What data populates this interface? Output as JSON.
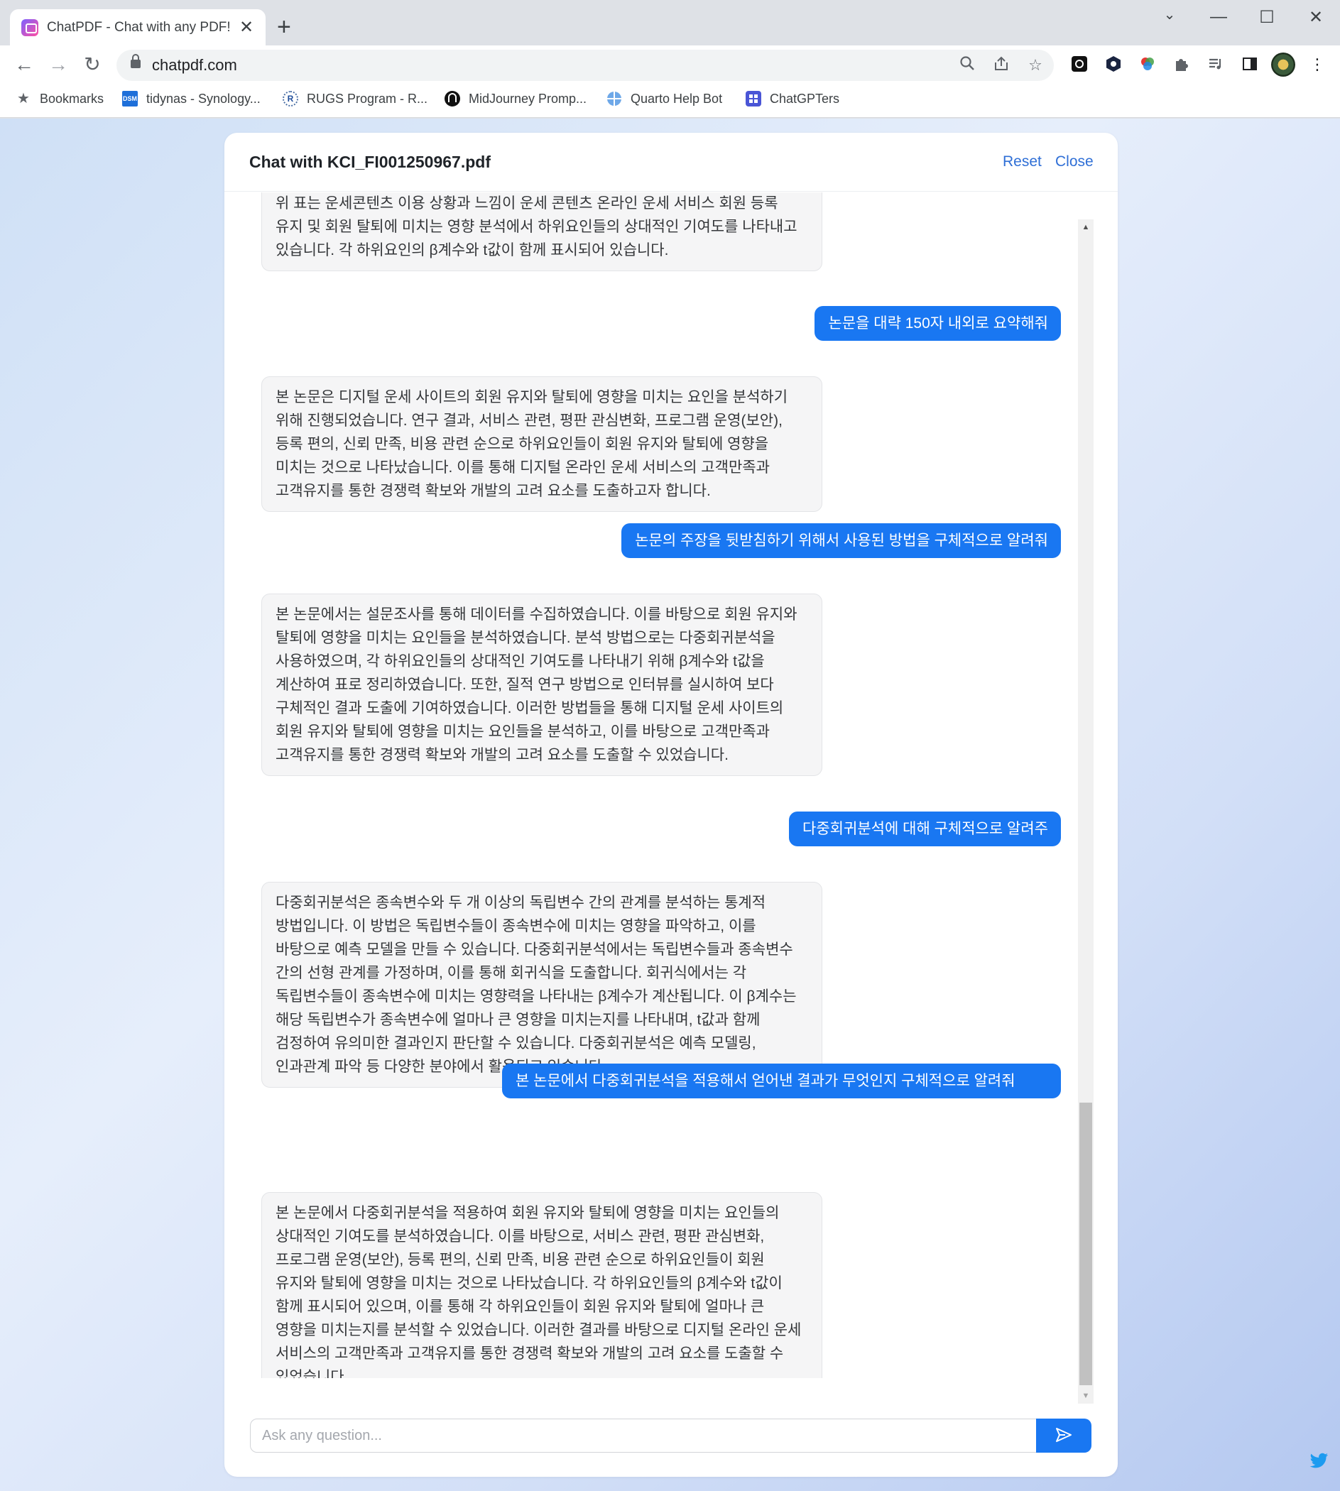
{
  "browser": {
    "tab_title": "ChatPDF - Chat with any PDF!",
    "tab_close": "✕",
    "new_tab": "+",
    "url": "chatpdf.com",
    "bookmarks": [
      {
        "label": "Bookmarks",
        "icon": "star-icon"
      },
      {
        "label": "tidynas - Synology...",
        "icon": "dsm-icon"
      },
      {
        "label": "RUGS Program - R...",
        "icon": "r-icon"
      },
      {
        "label": "MidJourney Promp...",
        "icon": "midjourney-icon"
      },
      {
        "label": "Quarto Help Bot",
        "icon": "globe-icon"
      },
      {
        "label": "ChatGPTers",
        "icon": "discord-icon"
      }
    ],
    "dsm_badge": "DSM",
    "r_badge": "R"
  },
  "chat": {
    "title": "Chat with KCI_FI001250967.pdf",
    "reset_label": "Reset",
    "close_label": "Close",
    "messages": [
      {
        "role": "ai",
        "text": "위 표는 운세콘텐츠 이용 상황과 느낌이 운세 콘텐츠 온라인 운세 서비스 회원 등록 유지 및 회원 탈퇴에 미치는 영향 분석에서 하위요인들의 상대적인 기여도를 나타내고 있습니다. 각 하위요인의 β계수와 t값이 함께 표시되어 있습니다."
      },
      {
        "role": "user",
        "text": "논문을 대략 150자 내외로 요약해줘"
      },
      {
        "role": "ai",
        "text": "본 논문은 디지털 운세 사이트의 회원 유지와 탈퇴에 영향을 미치는 요인을 분석하기 위해 진행되었습니다. 연구 결과, 서비스 관련, 평판 관심변화, 프로그램 운영(보안), 등록 편의, 신뢰 만족, 비용 관련 순으로 하위요인들이 회원 유지와 탈퇴에 영향을 미치는 것으로 나타났습니다. 이를 통해 디지털 온라인 운세 서비스의 고객만족과 고객유지를 통한 경쟁력 확보와 개발의 고려 요소를 도출하고자 합니다."
      },
      {
        "role": "user",
        "text": "논문의 주장을 뒷받침하기 위해서 사용된 방법을 구체적으로 알려줘"
      },
      {
        "role": "ai",
        "text": "본 논문에서는 설문조사를 통해 데이터를 수집하였습니다. 이를 바탕으로 회원 유지와 탈퇴에 영향을 미치는 요인들을 분석하였습니다. 분석 방법으로는 다중회귀분석을 사용하였으며, 각 하위요인들의 상대적인 기여도를 나타내기 위해 β계수와 t값을 계산하여 표로 정리하였습니다. 또한, 질적 연구 방법으로 인터뷰를 실시하여 보다 구체적인 결과 도출에 기여하였습니다. 이러한 방법들을 통해 디지털 운세 사이트의 회원 유지와 탈퇴에 영향을 미치는 요인들을 분석하고, 이를 바탕으로 고객만족과 고객유지를 통한 경쟁력 확보와 개발의 고려 요소를 도출할 수 있었습니다."
      },
      {
        "role": "user",
        "text": "다중회귀분석에 대해 구체적으로 알려주"
      },
      {
        "role": "ai",
        "text": "다중회귀분석은 종속변수와 두 개 이상의 독립변수 간의 관계를 분석하는 통계적 방법입니다. 이 방법은 독립변수들이 종속변수에 미치는 영향을 파악하고, 이를 바탕으로 예측 모델을 만들 수 있습니다. 다중회귀분석에서는 독립변수들과 종속변수 간의 선형 관계를 가정하며, 이를 통해 회귀식을 도출합니다. 회귀식에서는 각 독립변수들이 종속변수에 미치는 영향력을 나타내는 β계수가 계산됩니다. 이 β계수는 해당 독립변수가 종속변수에 얼마나 큰 영향을 미치는지를 나타내며, t값과 함께 검정하여 유의미한 결과인지 판단할 수 있습니다. 다중회귀분석은 예측 모델링, 인과관계 파악 등 다양한 분야에서 활용되고 있습니다."
      },
      {
        "role": "user",
        "text": "본 논문에서 다중회귀분석을 적용해서 얻어낸 결과가 무엇인지 구체적으로 알려줘"
      },
      {
        "role": "ai",
        "text": "본 논문에서 다중회귀분석을 적용하여 회원 유지와 탈퇴에 영향을 미치는 요인들의 상대적인 기여도를 분석하였습니다. 이를 바탕으로, 서비스 관련, 평판 관심변화, 프로그램 운영(보안), 등록 편의, 신뢰 만족, 비용 관련 순으로 하위요인들이 회원 유지와 탈퇴에 영향을 미치는 것으로 나타났습니다. 각 하위요인들의 β계수와 t값이 함께 표시되어 있으며, 이를 통해 각 하위요인들이 회원 유지와 탈퇴에 얼마나 큰 영향을 미치는지를 분석할 수 있었습니다. 이러한 결과를 바탕으로 디지털 온라인 운세 서비스의 고객만족과 고객유지를 통한 경쟁력 확보와 개발의 고려 요소를 도출할 수 있었습니다."
      }
    ],
    "input_placeholder": "Ask any question...",
    "input_value": "",
    "scroll_position": 1.0
  },
  "colors": {
    "accent": "#1977f2",
    "link": "#2f6fd6",
    "ai_bubble": "#f5f5f6"
  }
}
